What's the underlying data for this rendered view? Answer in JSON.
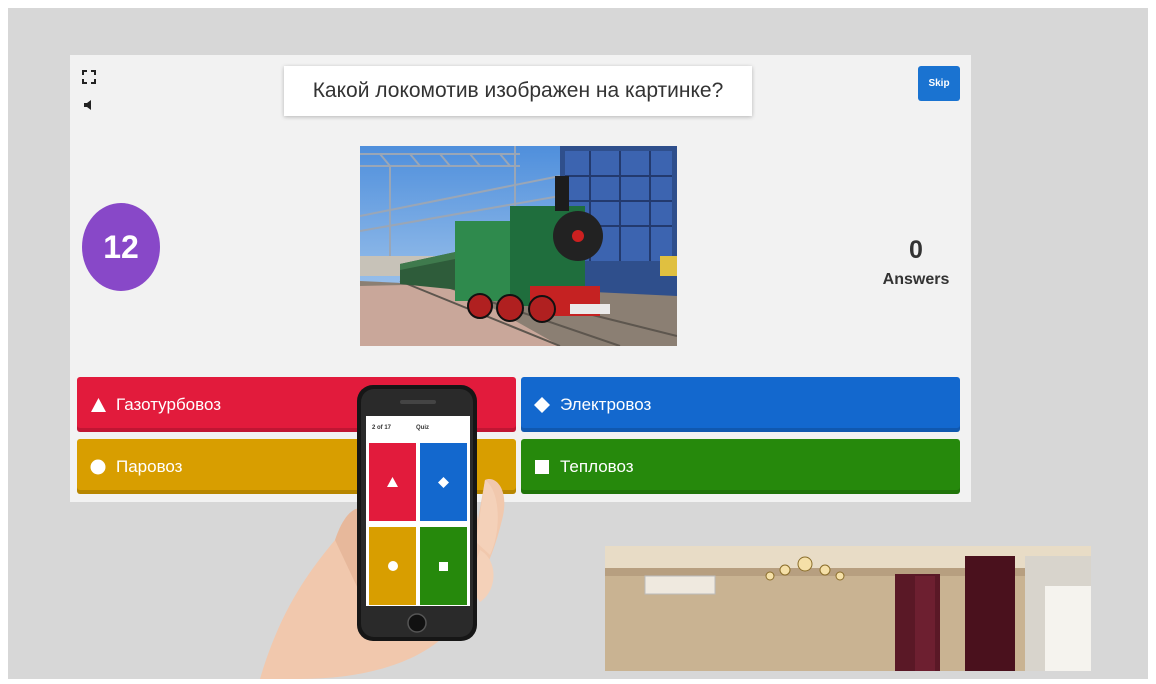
{
  "question": {
    "text": "Какой локомотив изображен на картинке?"
  },
  "controls": {
    "skip_label": "Skip",
    "fullscreen_icon": "fullscreen-icon",
    "sound_icon": "speaker-icon"
  },
  "timer": {
    "value": "12"
  },
  "answers_count": {
    "value": "0",
    "label": "Answers"
  },
  "answers": [
    {
      "label": "Газотурбовоз",
      "shape": "triangle",
      "color": "#e21b3c"
    },
    {
      "label": "Электровоз",
      "shape": "diamond",
      "color": "#1368ce"
    },
    {
      "label": "Паровоз",
      "shape": "circle",
      "color": "#d89e00"
    },
    {
      "label": "Тепловоз",
      "shape": "square",
      "color": "#26890c"
    }
  ],
  "phone": {
    "progress": "2 of 17",
    "app_label": "Quiz"
  },
  "colors": {
    "background": "#d7d7d7",
    "game_panel": "#f2f2f2",
    "timer": "#8848c8",
    "skip": "#1a73d1"
  }
}
